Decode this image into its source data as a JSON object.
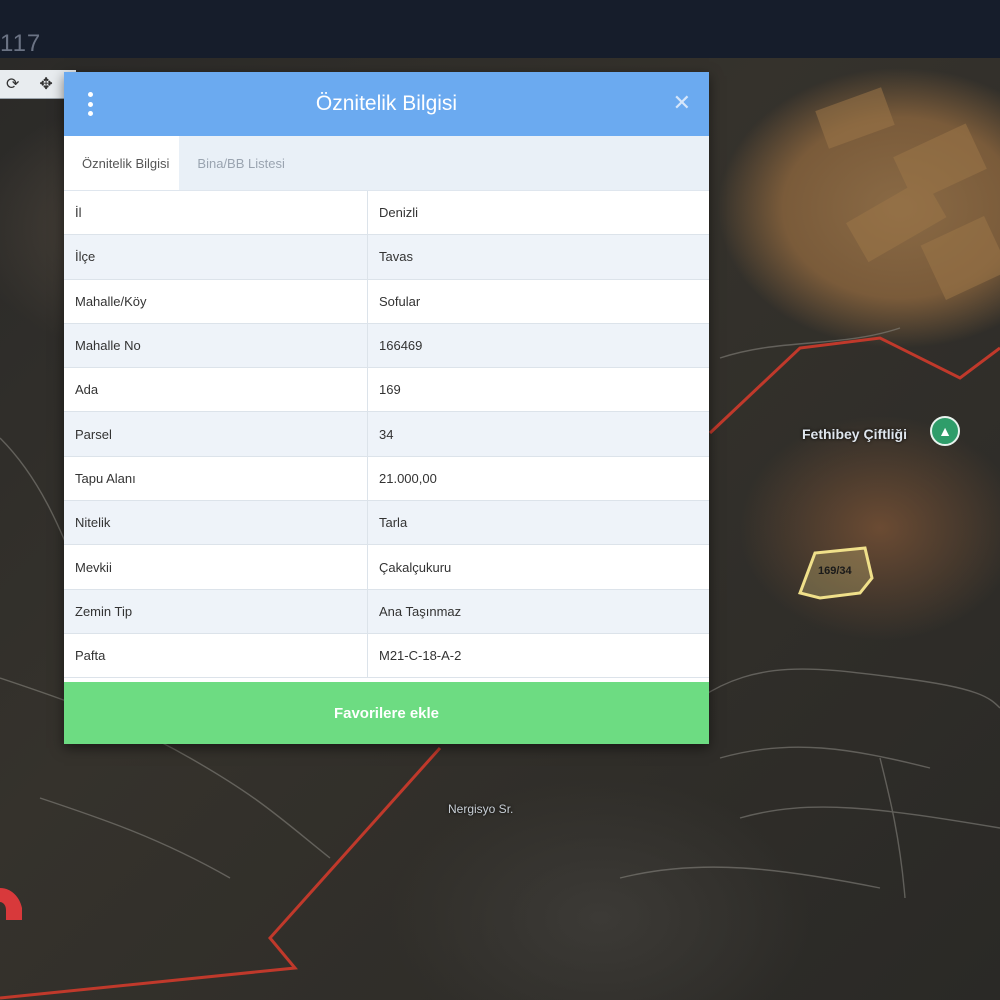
{
  "topbar": {
    "number": "117"
  },
  "map": {
    "poi_label": "Fethibey Çiftliği",
    "parcel_label": "169/34",
    "area_label": "Nergisyo Sr."
  },
  "modal": {
    "title": "Öznitelik Bilgisi",
    "tabs": [
      {
        "label": "Öznitelik Bilgisi",
        "active": true
      },
      {
        "label": "Bina/BB Listesi",
        "active": false
      }
    ],
    "rows": [
      {
        "key": "İl",
        "value": "Denizli"
      },
      {
        "key": "İlçe",
        "value": "Tavas"
      },
      {
        "key": "Mahalle/Köy",
        "value": "Sofular"
      },
      {
        "key": "Mahalle No",
        "value": "166469"
      },
      {
        "key": "Ada",
        "value": "169"
      },
      {
        "key": "Parsel",
        "value": "34"
      },
      {
        "key": "Tapu Alanı",
        "value": "21.000,00"
      },
      {
        "key": "Nitelik",
        "value": "Tarla"
      },
      {
        "key": "Mevkii",
        "value": "Çakalçukuru"
      },
      {
        "key": "Zemin Tip",
        "value": "Ana Taşınmaz"
      },
      {
        "key": "Pafta",
        "value": "M21-C-18-A-2"
      }
    ],
    "favorite_button": "Favorilere ekle"
  },
  "colors": {
    "header": "#6baaf0",
    "favorite": "#6ddc82",
    "boundary": "#c0392b",
    "parcel": "#f0e08a"
  }
}
